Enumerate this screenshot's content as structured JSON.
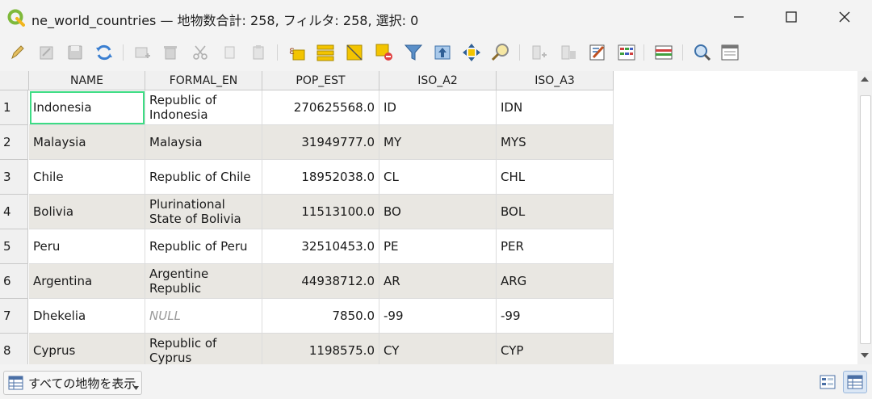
{
  "window": {
    "title": "ne_world_countries — 地物数合計: 258, フィルタ: 258, 選択: 0"
  },
  "toolbar": {
    "buttons": [
      "pencil-icon",
      "edit-multiple-icon",
      "save-icon",
      "reload-icon",
      "add-feature-icon",
      "delete-icon",
      "cut-icon",
      "copy-icon",
      "paste-icon",
      "expression-select-icon",
      "select-all-icon",
      "invert-selection-icon",
      "deselect-icon",
      "filter-icon",
      "move-selection-top-icon",
      "pan-to-selection-icon",
      "zoom-to-selection-icon",
      "new-field-icon",
      "delete-field-icon",
      "field-calculator-icon",
      "conditional-format-icon",
      "dock-icon",
      "actions-icon",
      "form-view-icon"
    ]
  },
  "table": {
    "columns": [
      "NAME",
      "FORMAL_EN",
      "POP_EST",
      "ISO_A2",
      "ISO_A3"
    ],
    "rows": [
      {
        "num": "1",
        "NAME": "Indonesia",
        "FORMAL_EN": "Republic of Indonesia",
        "POP_EST": "270625568.0",
        "ISO_A2": "ID",
        "ISO_A3": "IDN"
      },
      {
        "num": "2",
        "NAME": "Malaysia",
        "FORMAL_EN": "Malaysia",
        "POP_EST": "31949777.0",
        "ISO_A2": "MY",
        "ISO_A3": "MYS"
      },
      {
        "num": "3",
        "NAME": "Chile",
        "FORMAL_EN": "Republic of Chile",
        "POP_EST": "18952038.0",
        "ISO_A2": "CL",
        "ISO_A3": "CHL"
      },
      {
        "num": "4",
        "NAME": "Bolivia",
        "FORMAL_EN": "Plurinational State of Bolivia",
        "POP_EST": "11513100.0",
        "ISO_A2": "BO",
        "ISO_A3": "BOL"
      },
      {
        "num": "5",
        "NAME": "Peru",
        "FORMAL_EN": "Republic of Peru",
        "POP_EST": "32510453.0",
        "ISO_A2": "PE",
        "ISO_A3": "PER"
      },
      {
        "num": "6",
        "NAME": "Argentina",
        "FORMAL_EN": "Argentine Republic",
        "POP_EST": "44938712.0",
        "ISO_A2": "AR",
        "ISO_A3": "ARG"
      },
      {
        "num": "7",
        "NAME": "Dhekelia",
        "FORMAL_EN": "NULL",
        "POP_EST": "7850.0",
        "ISO_A2": "-99",
        "ISO_A3": "-99"
      },
      {
        "num": "8",
        "NAME": "Cyprus",
        "FORMAL_EN": "Republic of Cyprus",
        "POP_EST": "1198575.0",
        "ISO_A2": "CY",
        "ISO_A3": "CYP"
      }
    ]
  },
  "statusbar": {
    "filter_label": "すべての地物を表示"
  },
  "colors": {
    "selection_outline": "#3ddc84",
    "alt_row": "#e9e7e2"
  }
}
